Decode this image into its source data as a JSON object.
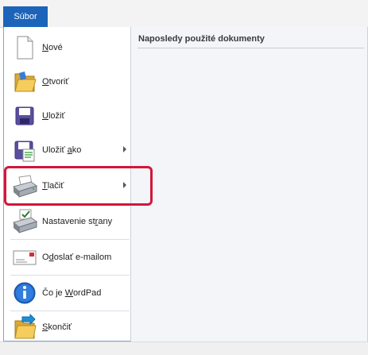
{
  "ribbon": {
    "file_tab": "Súbor"
  },
  "menu": {
    "items": [
      {
        "pre": "",
        "ul": "N",
        "post": "ové",
        "icon": "new-document-icon",
        "submenu": false
      },
      {
        "pre": "",
        "ul": "O",
        "post": "tvoriť",
        "icon": "open-folder-icon",
        "submenu": false
      },
      {
        "pre": "",
        "ul": "U",
        "post": "ložiť",
        "icon": "save-disk-icon",
        "submenu": false
      },
      {
        "pre": "Uložiť ",
        "ul": "a",
        "post": "ko",
        "icon": "save-as-icon",
        "submenu": true
      },
      {
        "pre": "",
        "ul": "T",
        "post": "lačiť",
        "icon": "printer-icon",
        "submenu": true
      },
      {
        "pre": "Nastavenie st",
        "ul": "r",
        "post": "any",
        "icon": "page-setup-icon",
        "submenu": false
      },
      {
        "pre": "O",
        "ul": "d",
        "post": "oslať e-mailom",
        "icon": "email-icon",
        "submenu": false
      },
      {
        "pre": "Čo je ",
        "ul": "W",
        "post": "ordPad",
        "icon": "info-icon",
        "submenu": false
      },
      {
        "pre": "",
        "ul": "S",
        "post": "končiť",
        "icon": "exit-icon",
        "submenu": false
      }
    ]
  },
  "recent": {
    "title": "Naposledy použité dokumenty"
  },
  "colors": {
    "file_tab": "#1c64b9",
    "highlight": "#d3163a"
  }
}
